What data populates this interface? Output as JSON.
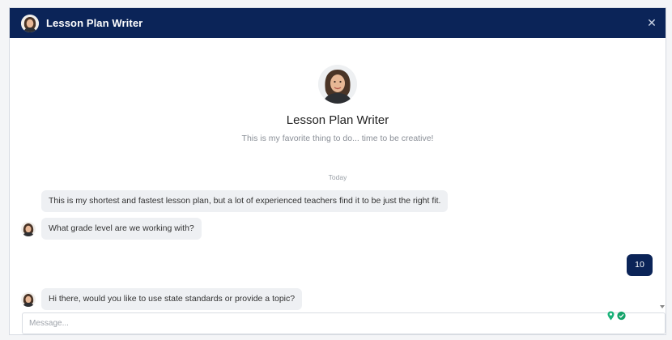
{
  "window": {
    "title": "Lesson Plan Writer",
    "close_symbol": "✕"
  },
  "profile": {
    "name": "Lesson Plan Writer",
    "tagline": "This is my favorite thing to do... time to be creative!"
  },
  "chat": {
    "day_label": "Today",
    "messages": [
      {
        "sender": "bot",
        "text": "This is my shortest and fastest lesson plan, but a lot of experienced teachers find it to be just the right fit."
      },
      {
        "sender": "bot",
        "text": "What grade level are we working with?"
      },
      {
        "sender": "user",
        "text": "10"
      },
      {
        "sender": "bot",
        "text": "Hi there, would you like to use state standards or provide a topic?"
      }
    ]
  },
  "composer": {
    "placeholder": "Message...",
    "value": ""
  },
  "colors": {
    "header_bg": "#0b2458",
    "user_bubble": "#0b2458",
    "bot_bubble": "#eef0f3",
    "accent_icon": "#1bb37a"
  },
  "icons": {
    "close": "close-icon",
    "location": "location-pin-icon",
    "grammar": "grammar-check-icon"
  }
}
